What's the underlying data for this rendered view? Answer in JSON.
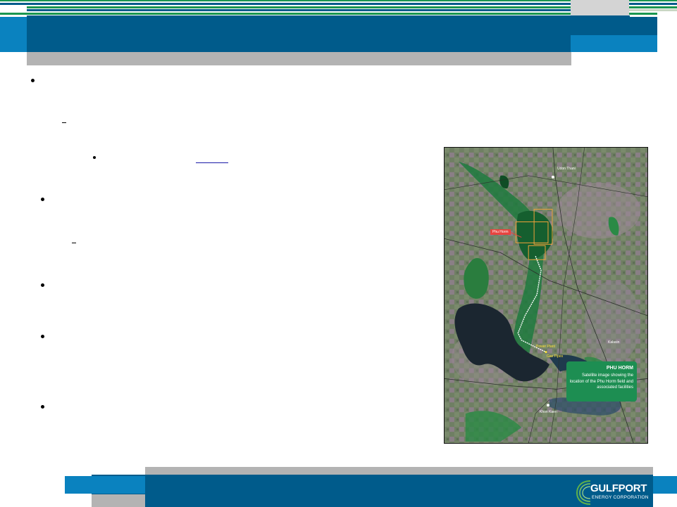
{
  "colors": {
    "header_dark_blue": "#005b8b",
    "header_light_blue": "#0a82bf",
    "stripe_green": "#1a9650",
    "gray": "#b3b3b3",
    "caption_green": "#1d8e52",
    "label_red": "#e8443f"
  },
  "map": {
    "labels": {
      "udon_thani": "Udon Thani",
      "phu_horm": "Phu Horm",
      "power_plant": "Power Plant",
      "gas_pipes": "Gas Pipes",
      "kalasin": "Kalasin",
      "khon_kaen": "Khon Kaen"
    },
    "caption": {
      "title": "PHU HORM",
      "body": "Satellite image showing the location of the Phu Horm field and associated facilities"
    }
  },
  "logo": {
    "name": "GULFPORT",
    "subtitle": "ENERGY CORPORATION"
  }
}
